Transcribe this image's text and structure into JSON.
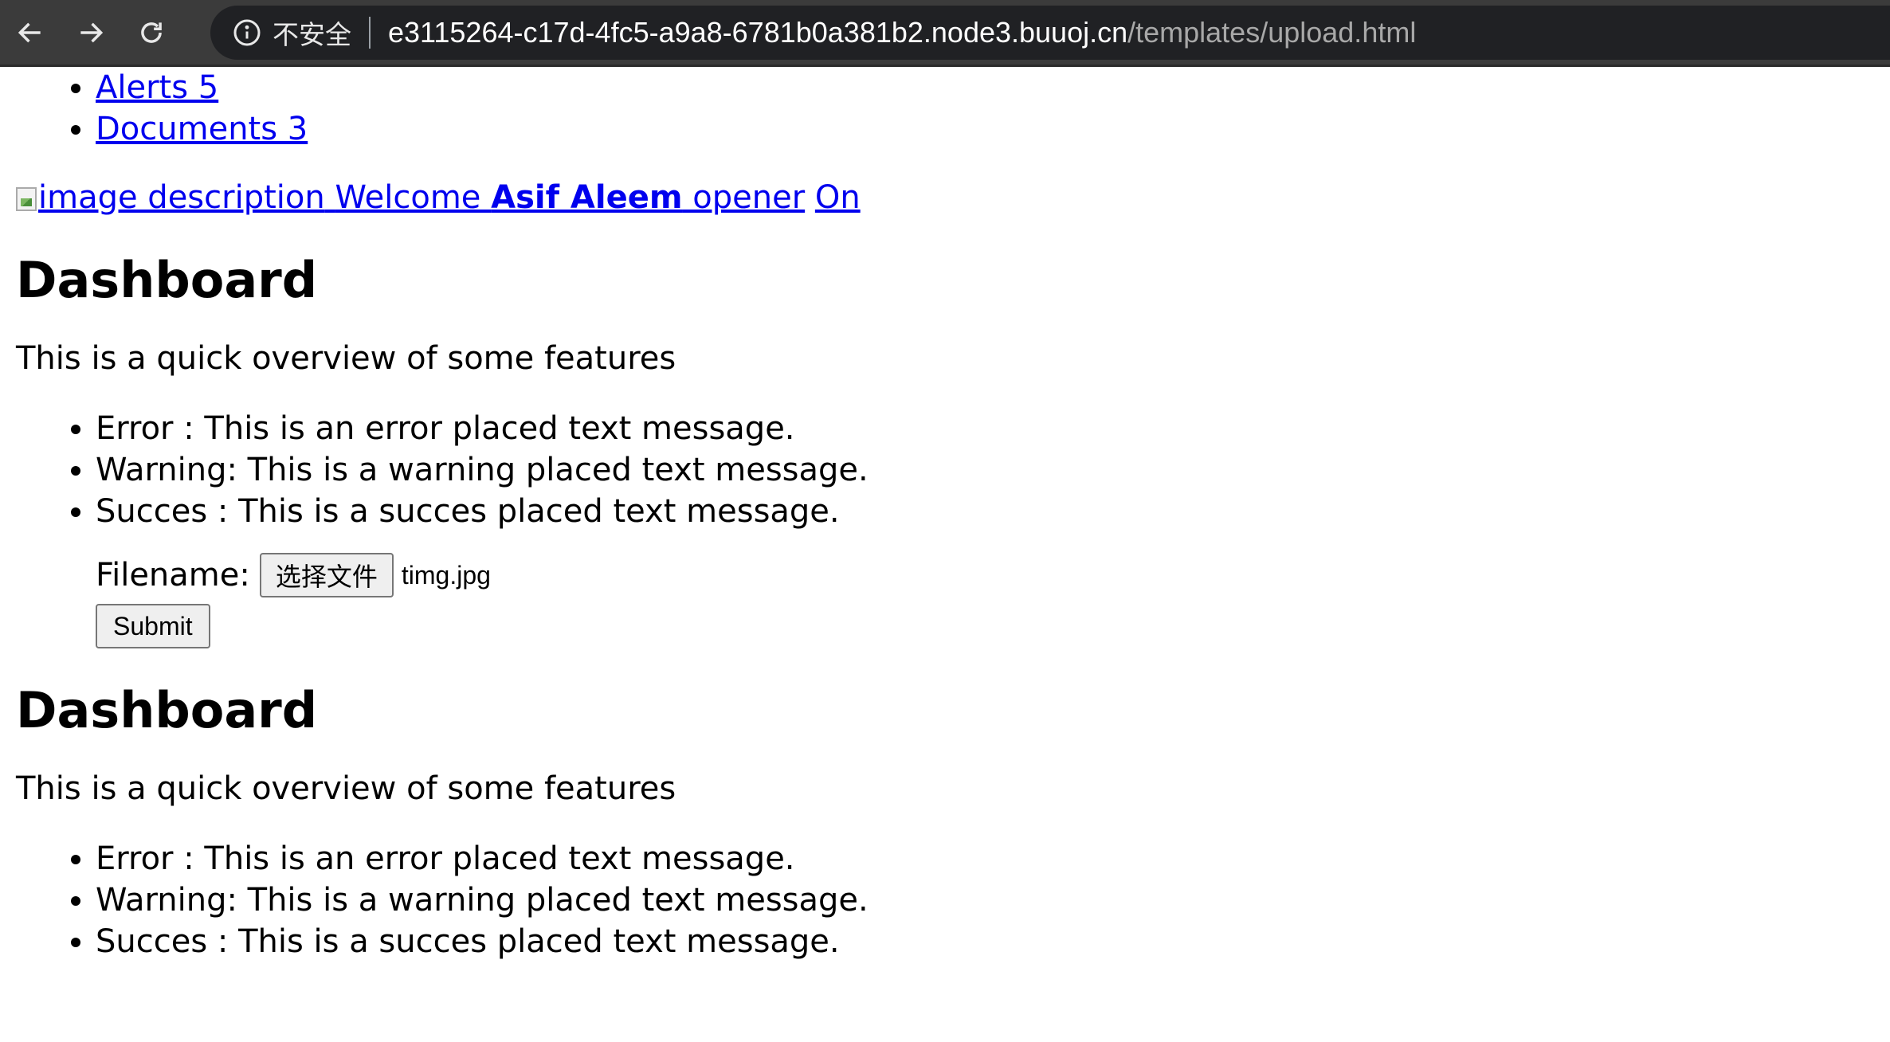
{
  "browser": {
    "security_text": "不安全",
    "url_host": "e3115264-c17d-4fc5-a9a8-6781b0a381b2.node3.buuoj.cn",
    "url_path": "/templates/upload.html",
    "icons": [
      "back-arrow-icon",
      "forward-arrow-icon",
      "reload-icon",
      "info-icon"
    ]
  },
  "nav_list": [
    {
      "label": "Alerts 5"
    },
    {
      "label": "Documents 3"
    }
  ],
  "welcome": {
    "image_alt": "image description",
    "welcome_text": "Welcome ",
    "user_name": "Asif Aleem",
    "opener_text": " opener",
    "on_link": "On"
  },
  "sections": [
    {
      "title": "Dashboard",
      "lead": "This is a quick overview of some features",
      "features": [
        "Error : This is an error placed text message.",
        "Warning: This is a warning placed text message.",
        "Succes : This is a succes placed text message."
      ]
    },
    {
      "title": "Dashboard",
      "lead": "This is a quick overview of some features",
      "features": [
        "Error : This is an error placed text message.",
        "Warning: This is a warning placed text message.",
        "Succes : This is a succes placed text message."
      ]
    }
  ],
  "upload_form": {
    "filename_label": "Filename:",
    "choose_button": "选择文件",
    "selected_file": "timg.jpg",
    "submit_label": "Submit"
  }
}
